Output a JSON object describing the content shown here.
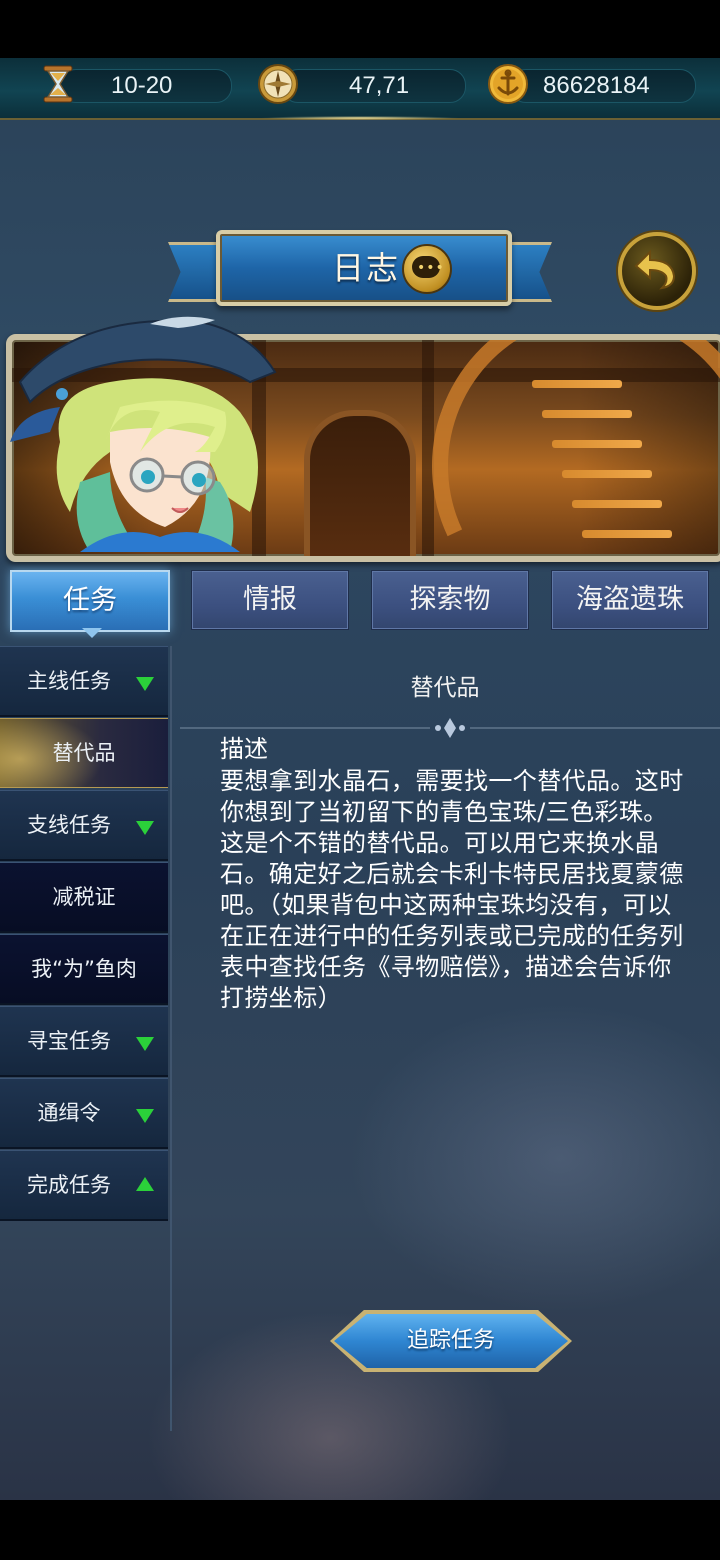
{
  "resources": {
    "time": {
      "icon": "hourglass-icon",
      "value": "10-20"
    },
    "coordinates": {
      "icon": "compass-icon",
      "value": "47,71"
    },
    "gold": {
      "icon": "anchor-coin-icon",
      "value": "86628184"
    }
  },
  "header": {
    "title": "日志",
    "chat_icon": "chat-bubble-icon",
    "back_icon": "return-arrow-icon"
  },
  "tabs": [
    {
      "label": "任务",
      "active": true
    },
    {
      "label": "情报",
      "active": false
    },
    {
      "label": "探索物",
      "active": false
    },
    {
      "label": "海盗遗珠",
      "active": false
    }
  ],
  "categories": [
    {
      "label": "主线任务",
      "expandable": true,
      "state": "collapsed"
    },
    {
      "label": "替代品",
      "sub": true,
      "selected": true
    },
    {
      "label": "支线任务",
      "expandable": true,
      "state": "collapsed"
    },
    {
      "label": "减税证",
      "sub": true
    },
    {
      "label": "我“为”鱼肉",
      "sub": true
    },
    {
      "label": "寻宝任务",
      "expandable": true,
      "state": "collapsed"
    },
    {
      "label": "通缉令",
      "expandable": true,
      "state": "collapsed"
    },
    {
      "label": "完成任务",
      "expandable": true,
      "state": "expanded"
    }
  ],
  "quest": {
    "title": "替代品",
    "description_heading": "描述",
    "description": "要想拿到水晶石，需要找一个替代品。这时你想到了当初留下的青色宝珠/三色彩珠。这是个不错的替代品。可以用它来换水晶石。确定好之后就会卡利卡特民居找夏蒙德吧。（如果背包中这两种宝珠均没有，可以在正在进行中的任务列表或已完成的任务列表中查找任务《寻物赔偿》，描述会告诉你打捞坐标）"
  },
  "track_button": {
    "label": "追踪任务"
  },
  "colors": {
    "accent_blue": "#3a8fd6",
    "gold_frame": "#c8a23a",
    "expand_green": "#2bd13a"
  }
}
